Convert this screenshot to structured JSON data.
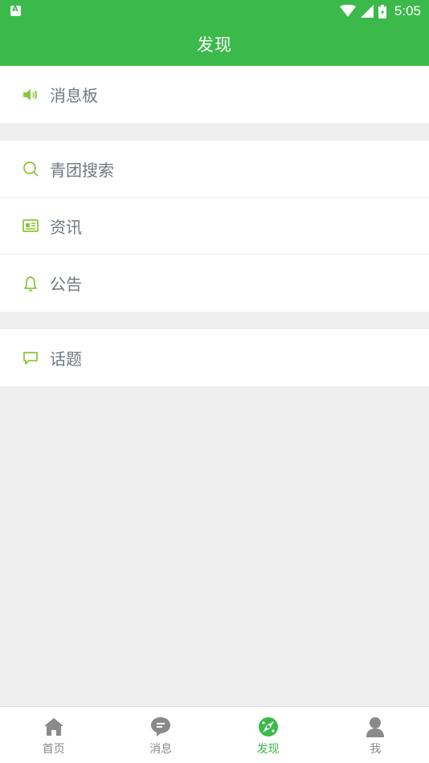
{
  "status_bar": {
    "time": "5:05"
  },
  "header": {
    "title": "发现"
  },
  "groups": [
    {
      "items": [
        {
          "label": "消息板",
          "icon": "speaker-icon"
        }
      ]
    },
    {
      "items": [
        {
          "label": "青团搜索",
          "icon": "search-icon"
        },
        {
          "label": "资讯",
          "icon": "news-icon"
        },
        {
          "label": "公告",
          "icon": "bell-icon"
        }
      ]
    },
    {
      "items": [
        {
          "label": "话题",
          "icon": "chat-bubble-icon"
        }
      ]
    }
  ],
  "tabbar": {
    "active_index": 2,
    "tabs": [
      {
        "label": "首页",
        "icon": "home-icon"
      },
      {
        "label": "消息",
        "icon": "message-icon"
      },
      {
        "label": "发现",
        "icon": "compass-icon"
      },
      {
        "label": "我",
        "icon": "person-icon"
      }
    ]
  },
  "colors": {
    "accent": "#3cb94b",
    "icon_green": "#8cc63f",
    "text": "#6f7880",
    "background": "#efefef"
  }
}
